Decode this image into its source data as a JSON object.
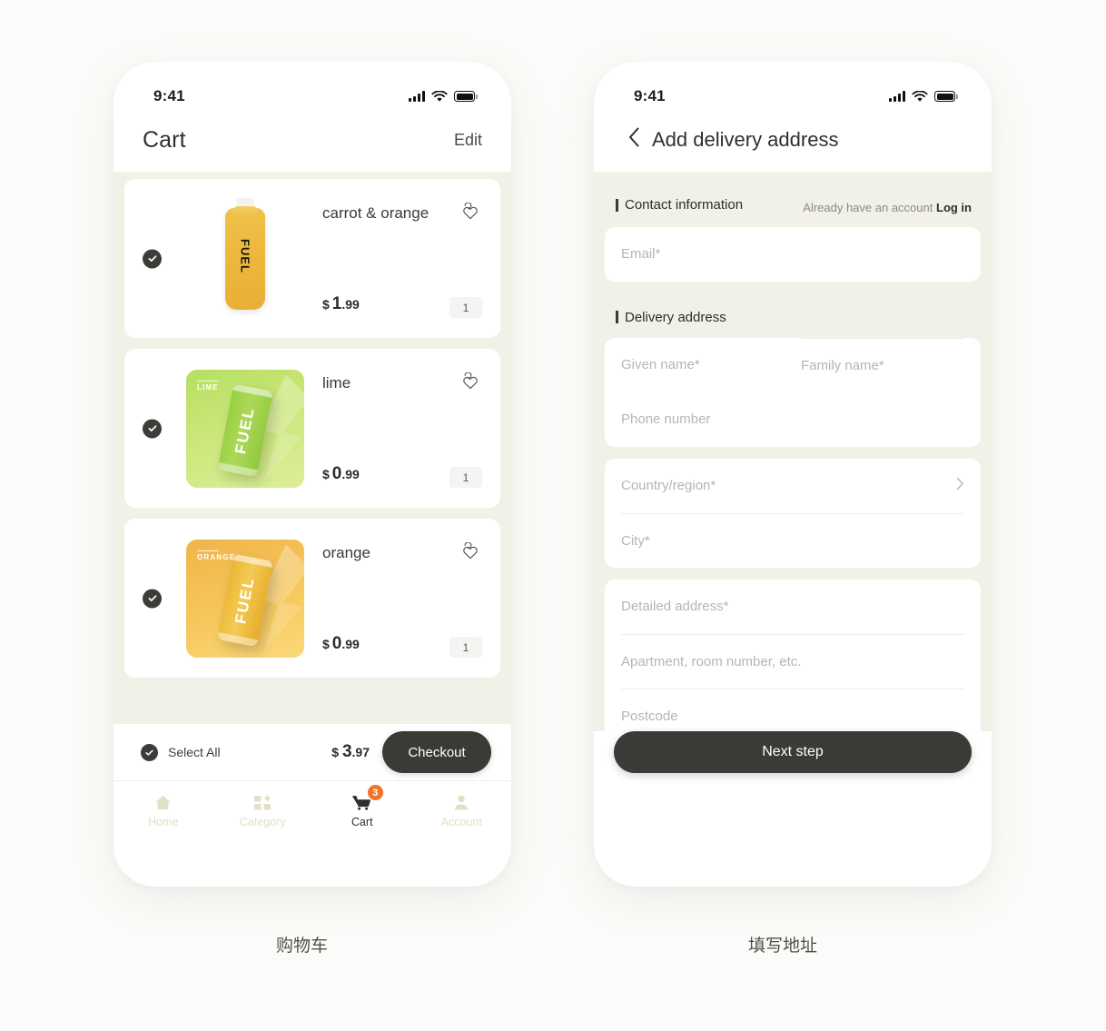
{
  "theme": {
    "accent_dark": "#3b3a36",
    "screen_bg": "#f2f1e8",
    "page_bg": "#fbfbf9",
    "badge_orange": "#f2742a",
    "tab_inactive": "#e2e0c4"
  },
  "cart_screen": {
    "status": {
      "time": "9:41",
      "signal_icon": "cellular-bars-icon",
      "wifi_icon": "wifi-icon",
      "battery_icon": "battery-full-icon"
    },
    "header": {
      "title": "Cart",
      "edit_label": "Edit"
    },
    "items": [
      {
        "name": "carrot & orange",
        "currency": "$",
        "price_major": "1",
        "price_minor": ".99",
        "qty": "1",
        "selected": true,
        "image_kind": "bottle",
        "brand": "FUEL",
        "tile_caption": ""
      },
      {
        "name": "lime",
        "currency": "$",
        "price_major": "0",
        "price_minor": ".99",
        "qty": "1",
        "selected": true,
        "image_kind": "can-lime",
        "brand": "FUEL",
        "tile_caption": "LIME"
      },
      {
        "name": "orange",
        "currency": "$",
        "price_major": "0",
        "price_minor": ".99",
        "qty": "1",
        "selected": true,
        "image_kind": "can-orange",
        "brand": "FUEL",
        "tile_caption": "ORANGE"
      }
    ],
    "footer": {
      "select_all_label": "Select All",
      "total_currency": "$",
      "total_major": "3",
      "total_minor": ".97",
      "checkout_label": "Checkout"
    },
    "tabs": [
      {
        "label": "Home",
        "icon": "home-icon",
        "active": false,
        "badge": ""
      },
      {
        "label": "Category",
        "icon": "grid-icon",
        "active": false,
        "badge": ""
      },
      {
        "label": "Cart",
        "icon": "cart-icon",
        "active": true,
        "badge": "3"
      },
      {
        "label": "Account",
        "icon": "person-icon",
        "active": false,
        "badge": ""
      }
    ]
  },
  "address_screen": {
    "status": {
      "time": "9:41",
      "signal_icon": "cellular-bars-icon",
      "wifi_icon": "wifi-icon",
      "battery_icon": "battery-full-icon"
    },
    "header": {
      "back_icon": "chevron-left-icon",
      "title": "Add delivery address"
    },
    "contact_section": {
      "title": "Contact information",
      "aside_text": "Already have an account",
      "login_label": "Log in"
    },
    "email_placeholder": "Email*",
    "delivery_section": {
      "title": "Delivery address"
    },
    "fields": {
      "given_name": "Given name*",
      "family_name": "Family name*",
      "phone_number": "Phone number",
      "country_region": "Country/region*",
      "city": "City*",
      "detailed_address": "Detailed address*",
      "apartment": "Apartment, room number, etc.",
      "postcode": "Postcode"
    },
    "next_label": "Next step"
  },
  "captions": {
    "left": "购物车",
    "right": "填写地址"
  }
}
